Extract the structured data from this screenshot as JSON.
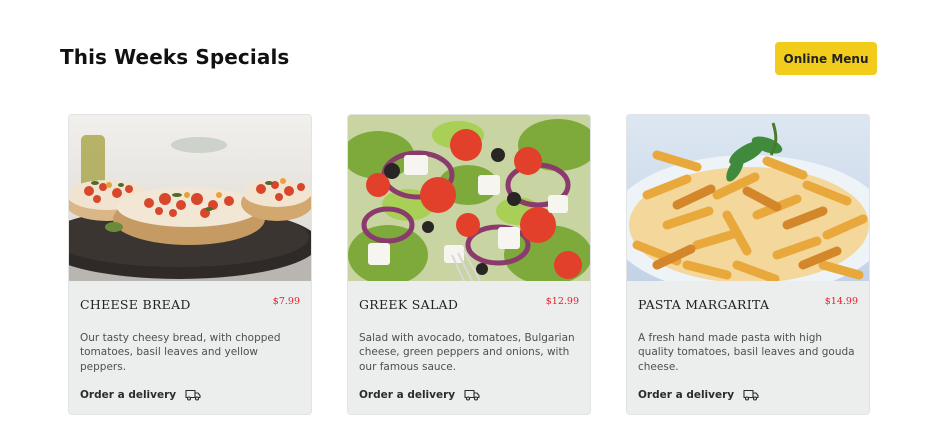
{
  "header": {
    "title": "This Weeks Specials",
    "menu_button": "Online Menu"
  },
  "colors": {
    "accent": "#f2cc1b",
    "price": "#e3202a",
    "card_bg": "#eceded"
  },
  "specials": [
    {
      "name": "CHEESE BREAD",
      "price": "$7.99",
      "description": "Our tasty cheesy bread, with chopped tomatoes, basil leaves and yellow peppers.",
      "order_label": "Order a delivery",
      "image": "bruschetta-photo",
      "icon": "delivery-truck-icon"
    },
    {
      "name": "GREEK SALAD",
      "price": "$12.99",
      "description": "Salad with avocado, tomatoes, Bulgarian cheese, green peppers and onions, with our famous sauce.",
      "order_label": "Order a delivery",
      "image": "greek-salad-photo",
      "icon": "delivery-truck-icon"
    },
    {
      "name": "PASTA MARGARITA",
      "price": "$14.99",
      "description": "A fresh hand made pasta with high quality tomatoes, basil leaves and gouda cheese.",
      "order_label": "Order a delivery",
      "image": "penne-pasta-photo",
      "icon": "delivery-truck-icon"
    }
  ]
}
